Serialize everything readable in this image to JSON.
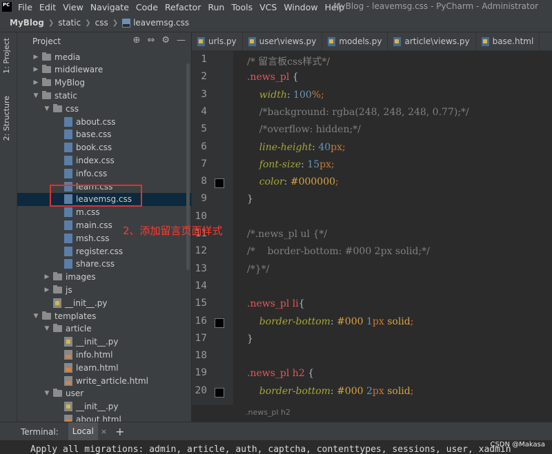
{
  "menubar": {
    "app_icon": "PC",
    "items": [
      "File",
      "Edit",
      "View",
      "Navigate",
      "Code",
      "Refactor",
      "Run",
      "Tools",
      "VCS",
      "Window",
      "Help"
    ],
    "window_title": "MyBlog - leavemsg.css - PyCharm - Administrator"
  },
  "breadcrumb": [
    "MyBlog",
    "static",
    "css",
    "leavemsg.css"
  ],
  "side_tabs": [
    "1: Project",
    "2: Structure"
  ],
  "project_panel": {
    "title": "Project"
  },
  "tree": [
    {
      "label": "media",
      "type": "folder",
      "arrow": "▶"
    },
    {
      "label": "middleware",
      "type": "folder",
      "arrow": "▶"
    },
    {
      "label": "MyBlog",
      "type": "folder",
      "arrow": "▶"
    },
    {
      "label": "static",
      "type": "folder",
      "arrow": "▼"
    },
    {
      "label": "css",
      "type": "folder",
      "arrow": "▼"
    },
    {
      "label": "about.css",
      "type": "css"
    },
    {
      "label": "base.css",
      "type": "css"
    },
    {
      "label": "book.css",
      "type": "css"
    },
    {
      "label": "index.css",
      "type": "css"
    },
    {
      "label": "info.css",
      "type": "css"
    },
    {
      "label": "learn.css",
      "type": "css"
    },
    {
      "label": "leavemsg.css",
      "type": "css",
      "selected": true
    },
    {
      "label": "m.css",
      "type": "css"
    },
    {
      "label": "main.css",
      "type": "css"
    },
    {
      "label": "msh.css",
      "type": "css"
    },
    {
      "label": "register.css",
      "type": "css"
    },
    {
      "label": "share.css",
      "type": "css"
    },
    {
      "label": "images",
      "type": "folder",
      "arrow": "▶"
    },
    {
      "label": "js",
      "type": "folder",
      "arrow": "▶"
    },
    {
      "label": "__init__.py",
      "type": "py"
    },
    {
      "label": "templates",
      "type": "folder",
      "arrow": "▼"
    },
    {
      "label": "article",
      "type": "folder",
      "arrow": "▼"
    },
    {
      "label": "__init__.py",
      "type": "py"
    },
    {
      "label": "info.html",
      "type": "html"
    },
    {
      "label": "learn.html",
      "type": "html"
    },
    {
      "label": "write_article.html",
      "type": "html"
    },
    {
      "label": "user",
      "type": "folder",
      "arrow": "▼"
    },
    {
      "label": "__init__.py",
      "type": "py"
    },
    {
      "label": "about.html",
      "type": "html"
    }
  ],
  "annotation": "2、添加留言页面样式",
  "tabs": [
    "urls.py",
    "user\\views.py",
    "models.py",
    "article\\views.py",
    "base.html"
  ],
  "code_lines": [
    [
      {
        "t": "/* 留言板css样式*/",
        "c": "cm"
      }
    ],
    [
      {
        "t": ".news_pl",
        "c": "sel"
      },
      {
        "t": " {",
        "c": ""
      }
    ],
    [
      {
        "t": "    width",
        "c": "prop"
      },
      {
        "t": ": ",
        "c": ""
      },
      {
        "t": "100",
        "c": "num"
      },
      {
        "t": "%;",
        "c": "unit"
      }
    ],
    [
      {
        "t": "    /*background: rgba(248, 248, 248, 0.77);*/",
        "c": "cm"
      }
    ],
    [
      {
        "t": "    /*overflow: hidden;*/",
        "c": "cm"
      }
    ],
    [
      {
        "t": "    line-height",
        "c": "prop"
      },
      {
        "t": ": ",
        "c": ""
      },
      {
        "t": "40",
        "c": "num"
      },
      {
        "t": "px",
        "c": "unit"
      },
      {
        "t": ";",
        "c": "unit"
      }
    ],
    [
      {
        "t": "    font-size",
        "c": "prop"
      },
      {
        "t": ": ",
        "c": ""
      },
      {
        "t": "15",
        "c": "num"
      },
      {
        "t": "px",
        "c": "unit"
      },
      {
        "t": ";",
        "c": "unit"
      }
    ],
    [
      {
        "t": "    color",
        "c": "prop"
      },
      {
        "t": ": ",
        "c": ""
      },
      {
        "t": "#000000",
        "c": "hex"
      },
      {
        "t": ";",
        "c": "unit"
      }
    ],
    [
      {
        "t": "}",
        "c": ""
      }
    ],
    [
      {
        "t": "",
        "c": ""
      }
    ],
    [
      {
        "t": "/*.news_pl ul {*/",
        "c": "cm"
      }
    ],
    [
      {
        "t": "/*    border-bottom: #000 2px solid;*/",
        "c": "cm"
      }
    ],
    [
      {
        "t": "/*}*/",
        "c": "cm"
      }
    ],
    [
      {
        "t": "",
        "c": ""
      }
    ],
    [
      {
        "t": ".news_pl li",
        "c": "sel"
      },
      {
        "t": "{",
        "c": ""
      }
    ],
    [
      {
        "t": "    border-bottom",
        "c": "prop"
      },
      {
        "t": ": ",
        "c": ""
      },
      {
        "t": "#000",
        "c": "hex"
      },
      {
        "t": " ",
        "c": ""
      },
      {
        "t": "1",
        "c": "num"
      },
      {
        "t": "px",
        "c": "unit"
      },
      {
        "t": " solid",
        "c": "hex"
      },
      {
        "t": ";",
        "c": "unit"
      }
    ],
    [
      {
        "t": "}",
        "c": ""
      }
    ],
    [
      {
        "t": "",
        "c": ""
      }
    ],
    [
      {
        "t": ".news_pl h2",
        "c": "sel"
      },
      {
        "t": " {",
        "c": ""
      }
    ],
    [
      {
        "t": "    border-bottom",
        "c": "prop"
      },
      {
        "t": ": ",
        "c": ""
      },
      {
        "t": "#000",
        "c": "hex"
      },
      {
        "t": " ",
        "c": ""
      },
      {
        "t": "2",
        "c": "num"
      },
      {
        "t": "px",
        "c": "unit"
      },
      {
        "t": " solid",
        "c": "hex"
      },
      {
        "t": ";",
        "c": "unit"
      }
    ]
  ],
  "color_swatch_lines": [
    8,
    16,
    20
  ],
  "fold_lines": [
    2,
    9,
    15,
    17,
    19
  ],
  "editor_breadcrumb": ".news_pl h2",
  "terminal": {
    "label": "Terminal:",
    "tab": "Local",
    "close": "×",
    "add": "+",
    "output": "Apply all migrations: admin, article, auth, captcha, contenttypes, sessions, user, xadmin"
  },
  "watermark": "CSDN @Makasa"
}
